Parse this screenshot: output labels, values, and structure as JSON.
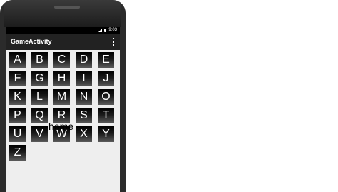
{
  "status_bar": {
    "time": "9:03",
    "icons": [
      "signal-icon",
      "battery-icon"
    ]
  },
  "action_bar": {
    "title": "GameActivity",
    "menu_icon": "overflow-menu-icon"
  },
  "letters": [
    "A",
    "B",
    "C",
    "D",
    "E",
    "F",
    "G",
    "H",
    "I",
    "J",
    "K",
    "L",
    "M",
    "N",
    "O",
    "P",
    "Q",
    "R",
    "S",
    "T",
    "U",
    "V",
    "W",
    "X",
    "Y",
    "Z"
  ],
  "overlay_text": "home",
  "colors": {
    "status_bar": "#000000",
    "action_bar": "#222222",
    "screen_background": "#eeeeee",
    "key_text": "#ffffff"
  }
}
